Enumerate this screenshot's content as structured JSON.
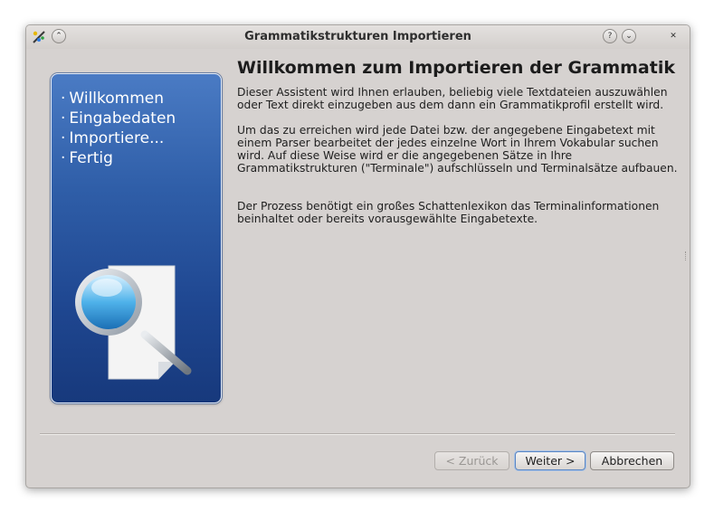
{
  "window": {
    "title": "Grammatikstrukturen Importieren",
    "buttons": {
      "help": "?",
      "minimize": "⌄",
      "close": "✕",
      "shade": "⌃"
    }
  },
  "steps": [
    {
      "dot": "·",
      "label": "Willkommen"
    },
    {
      "dot": "·",
      "label": "Eingabedaten"
    },
    {
      "dot": "·",
      "label": "Importiere..."
    },
    {
      "dot": "·",
      "label": "Fertig"
    }
  ],
  "content": {
    "heading": "Willkommen zum Importieren der Grammatik",
    "paragraphs": [
      "Dieser Assistent wird Ihnen erlauben, beliebig viele Textdateien auszuwählen oder Text direkt einzugeben aus dem dann ein Grammatikprofil erstellt wird.",
      "Um das zu erreichen wird jede Datei bzw. der angegebene Eingabetext mit einem Parser bearbeitet der jedes einzelne Wort in Ihrem Vokabular suchen wird. Auf diese Weise wird er die angegebenen Sätze in Ihre Grammatikstrukturen (\"Terminale\") aufschlüsseln und Terminalsätze aufbauen.",
      "Der Prozess benötigt ein großes Schattenlexikon das Terminalinformationen beinhaltet oder bereits vorausgewählte Eingabetexte."
    ]
  },
  "footer": {
    "back": "< Zurück",
    "next": "Weiter >",
    "cancel": "Abbrechen"
  },
  "colors": {
    "panel_top": "#4a7bc4",
    "panel_bottom": "#17397c",
    "window_bg": "#d6d2d0"
  },
  "icons": {
    "app": "brush-icon",
    "illustration": "magnifier-document-icon"
  }
}
